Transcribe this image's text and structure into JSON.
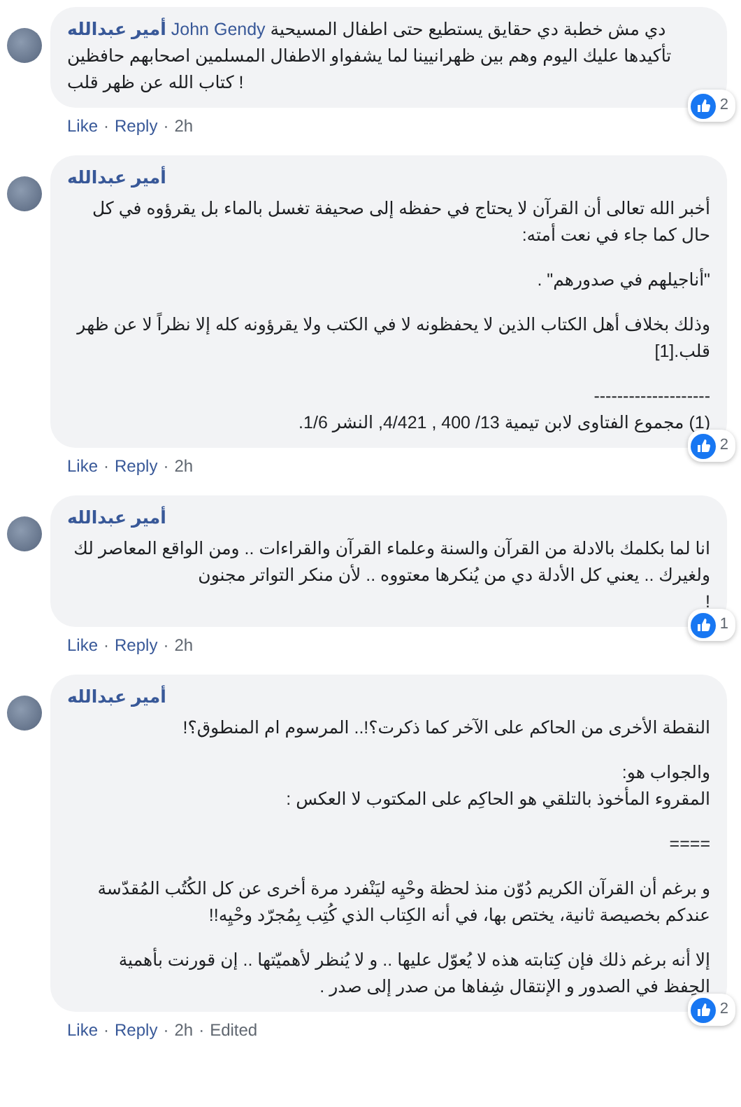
{
  "comments": [
    {
      "author": "أمير عبدالله",
      "mention": "John Gendy",
      "paragraphs": [
        "دي مش خطبة دي حقايق يستطيع حتى اطفال المسيحية تأكيدها عليك اليوم وهم بين ظهرانيينا لما يشفواو الاطفال المسلمين اصحابهم حافظين كتاب الله عن ظهر قلب !"
      ],
      "reactions": "2",
      "footer": {
        "like": "Like",
        "sep_1": "·",
        "reply": "Reply",
        "sep_2": "·",
        "time": "2h"
      }
    },
    {
      "author": "أمير عبدالله",
      "paragraphs": [
        "أخبر الله تعالى أن القرآن لا يحتاج في حفظه إلى صحيفة تغسل بالماء بل يقرؤوه في كل حال كما جاء في نعت أمته:",
        "\"أناجيلهم في صدورهم\" .",
        "وذلك بخلاف أهل الكتاب الذين لا يحفظونه لا في الكتب ولا يقرؤونه كله إلا نظراً لا عن ظهر قلب.[1]",
        "--------------------\n(1) مجموع الفتاوى لابن تيمية 13/ 400 , 4/421, النشر 1/6."
      ],
      "reactions": "2",
      "footer": {
        "like": "Like",
        "sep_1": "·",
        "reply": "Reply",
        "sep_2": "·",
        "time": "2h"
      }
    },
    {
      "author": "أمير عبدالله",
      "paragraphs": [
        "انا لما بكلمك بالادلة من القرآن والسنة وعلماء القرآن والقراءات .. ومن الواقع المعاصر لك ولغيرك .. يعني كل الأدلة دي من يُنكرها معتووه .. لأن منكر التواتر مجنون\n!"
      ],
      "reactions": "1",
      "footer": {
        "like": "Like",
        "sep_1": "·",
        "reply": "Reply",
        "sep_2": "·",
        "time": "2h"
      }
    },
    {
      "author": "أمير عبدالله",
      "paragraphs": [
        "النقطة الأخرى من الحاكم على الآخر كما ذكرت؟!.. المرسوم ام المنطوق؟!",
        "والجواب هو:\nالمقروء المأخوذ بالتلقي هو الحاكِم على المكتوب لا العكس :",
        "====",
        "و برغم أن القرآن الكريم دُوّن منذ لحظة وحْيِه ليَنْفرد مرة أخرى عن كل الكُتُب المُقدّسة عندكم بخصيصة ثانية، يختص بها، في أنه الكِتاب الذي كُتِب بِمُجرّد وحْيِه!!",
        "إلا أنه برغم ذلك فإن كِتابته هذه لا يُعوّل عليها .. و لا يُنظر لأهميّتها .. إن قورنت بأهمية الحِفظ في الصدور و الإنتقال شِفاها من صدر إلى صدر ."
      ],
      "reactions": "2",
      "footer": {
        "like": "Like",
        "sep_1": "·",
        "reply": "Reply",
        "sep_2": "·",
        "time": "2h",
        "sep_3": "·",
        "edited": "Edited"
      }
    }
  ]
}
